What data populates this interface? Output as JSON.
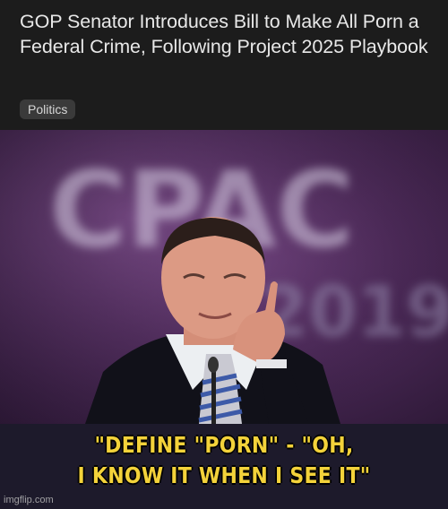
{
  "article": {
    "headline": "GOP Senator Introduces Bill to Make All Porn a Federal Crime, Following Project 2025 Playbook",
    "category_tag": "Politics"
  },
  "photo": {
    "backdrop_text": "CPAC",
    "backdrop_year": "2019"
  },
  "meme": {
    "caption_line1": "\"DEFINE \"PORN\" - \"OH,",
    "caption_line2": "I KNOW IT WHEN I SEE IT\""
  },
  "watermark": "imgflip.com"
}
